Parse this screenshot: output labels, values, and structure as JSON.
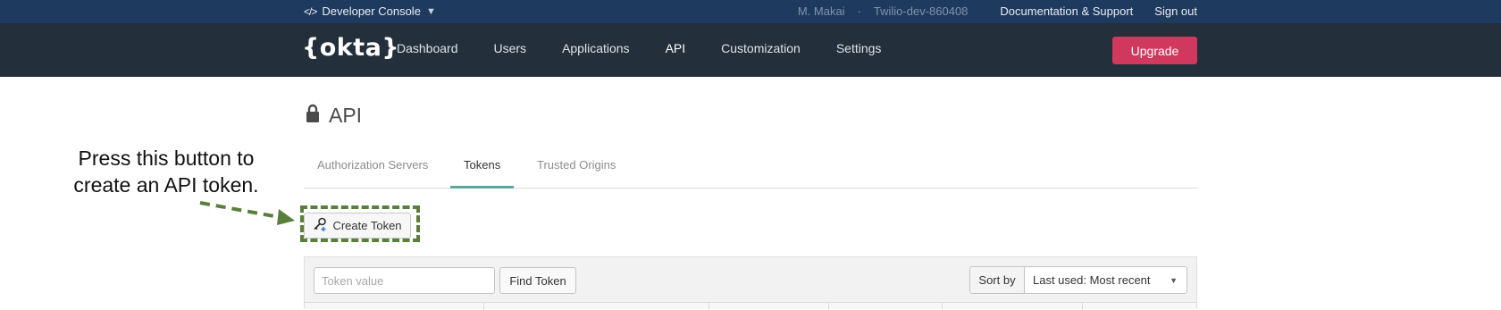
{
  "topbar": {
    "console_label": "Developer Console",
    "code_icon": "</>",
    "caret_icon": "▼",
    "user": "M. Makai",
    "separator": "·",
    "org": "Twilio-dev-860408",
    "docs_link": "Documentation & Support",
    "signout_link": "Sign out"
  },
  "nav": {
    "logo": "{okta}",
    "items": [
      {
        "label": "Dashboard"
      },
      {
        "label": "Users"
      },
      {
        "label": "Applications"
      },
      {
        "label": "API"
      },
      {
        "label": "Customization"
      },
      {
        "label": "Settings"
      }
    ],
    "active_item": "API",
    "upgrade_label": "Upgrade"
  },
  "page": {
    "title": "API",
    "tabs": [
      {
        "label": "Authorization Servers"
      },
      {
        "label": "Tokens"
      },
      {
        "label": "Trusted Origins"
      }
    ],
    "active_tab": "Tokens",
    "create_token_label": "Create Token"
  },
  "annotation": {
    "line1": "Press this button to",
    "line2": "create an API token."
  },
  "search": {
    "placeholder": "Token value",
    "value": "",
    "find_label": "Find Token",
    "sort_label": "Sort by",
    "sort_value": "Last used: Most recent"
  },
  "colors": {
    "topbar_bg": "#1f3a5f",
    "navbar_bg": "#232f3a",
    "upgrade_bg": "#d1385e",
    "tab_accent": "#5aa899",
    "annotation_green": "#5a7f3b"
  }
}
